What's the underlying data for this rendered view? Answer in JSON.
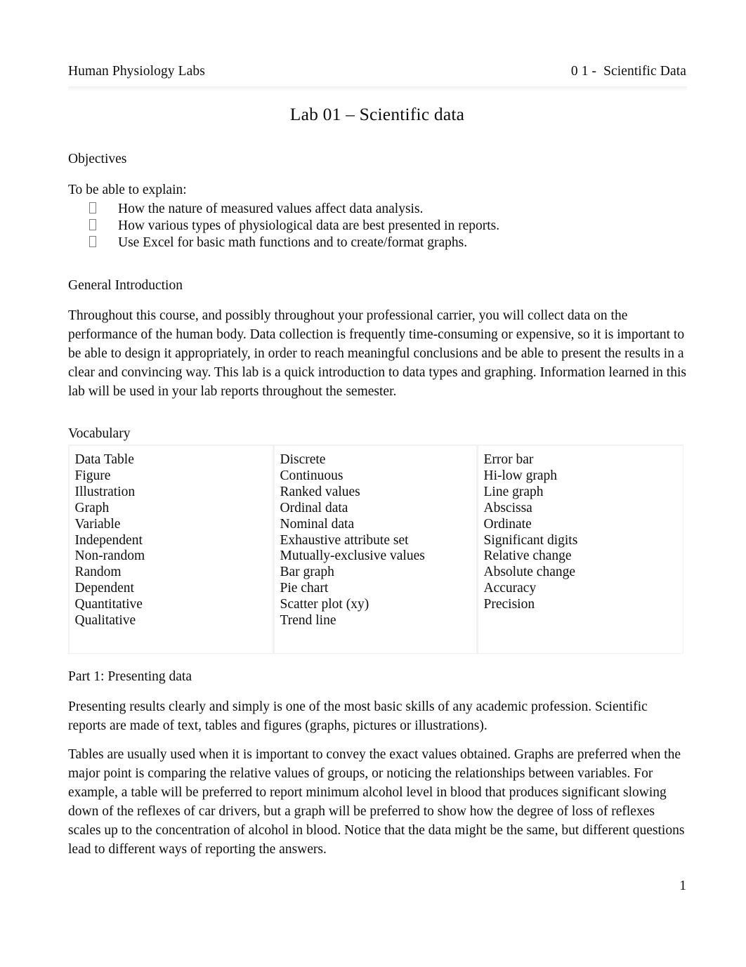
{
  "header": {
    "left": "Human Physiology Labs",
    "right": "0 1 -  Scientific Data"
  },
  "title": "Lab 01 – Scientific data",
  "objectives": {
    "heading": "Objectives",
    "lead_in": "To be able to explain:",
    "bullet_glyph": "missing-glyph-box",
    "items": [
      "How the nature of measured values affect data analysis.",
      "How various types of physiological data are best presented in reports.",
      "Use Excel for basic math functions and to create/format graphs."
    ]
  },
  "general_introduction": {
    "heading": "General Introduction",
    "body": "Throughout this course, and possibly throughout your professional carrier, you will collect data on the performance of the human body. Data collection is frequently time-consuming or expensive, so it is important to be able to design it appropriately, in order to reach meaningful conclusions and be able to present the results in a clear and convincing way. This lab is a quick introduction to data types and graphing. Information learned in this lab will be used in your lab reports throughout the semester."
  },
  "vocabulary": {
    "heading": "Vocabulary",
    "columns": [
      {
        "items": [
          "Data Table",
          "Figure",
          "Illustration",
          "Graph",
          "Variable",
          "Independent",
          "Non-random",
          "Random",
          "Dependent",
          "Quantitative",
          "Qualitative"
        ]
      },
      {
        "items": [
          "Discrete",
          "Continuous",
          "Ranked values",
          "Ordinal data",
          "Nominal data",
          "Exhaustive attribute set",
          "Mutually-exclusive values",
          "Bar graph",
          "Pie chart",
          "Scatter plot (xy)",
          "Trend line"
        ]
      },
      {
        "items": [
          "Error bar",
          "Hi-low graph",
          "Line graph",
          "Abscissa",
          "Ordinate",
          "Significant digits",
          "Relative change",
          "Absolute change",
          "Accuracy",
          "Precision"
        ]
      }
    ]
  },
  "part1": {
    "heading": "Part 1: Presenting data",
    "paragraph1": "Presenting results clearly and simply is one of the most basic skills of any academic profession. Scientific reports are made of text, tables and figures (graphs, pictures or illustrations).",
    "paragraph2": "Tables are usually used when it is important to convey the exact values obtained. Graphs are preferred when the major point is comparing the relative values of groups, or noticing the relationships between variables. For example, a table will be preferred to report minimum alcohol level in blood that produces significant slowing down of the reflexes of car drivers, but a graph will be preferred to show how the degree of loss of reflexes scales up to the concentration of alcohol in blood. Notice that the data might be the same, but different questions lead to different ways of reporting the answers."
  },
  "footer": {
    "page_number": "1"
  }
}
